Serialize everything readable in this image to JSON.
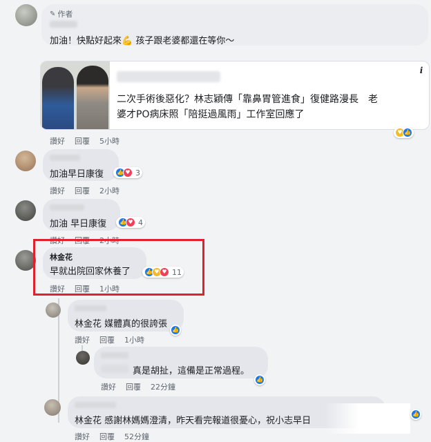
{
  "comments": [
    {
      "author_badge": "作者",
      "text": "加油！快點好起來💪 孩子跟老婆都還在等你～",
      "link_preview": {
        "headline_line1": "二次手術後惡化？林志穎傳「靠鼻胃管進食」復健路漫長　老",
        "headline_line2": "婆才PO病床照「陪挺過風雨」工作室回應了",
        "info_icon": "i"
      },
      "meta": {
        "like": "讚好",
        "reply": "回覆",
        "time": "5小時"
      }
    },
    {
      "text": "加油早日康復",
      "reaction_count": "3",
      "meta": {
        "like": "讚好",
        "reply": "回覆",
        "time": "2小時"
      }
    },
    {
      "text": "加油 早日康復",
      "reaction_count": "4",
      "meta": {
        "like": "讚好",
        "reply": "回覆",
        "time": "2小時"
      }
    },
    {
      "author": "林金花",
      "text": "早就出院回家休養了",
      "reaction_count": "11",
      "meta": {
        "like": "讚好",
        "reply": "回覆",
        "time": "1小時"
      }
    }
  ],
  "replies": [
    {
      "text": "林金花 媒體真的很誇張",
      "meta": {
        "like": "讚好",
        "reply": "回覆",
        "time": "1小時"
      }
    },
    {
      "text": "真是胡扯，這備是正常過程。",
      "meta": {
        "like": "讚好",
        "reply": "回覆",
        "time": "22分鐘"
      }
    },
    {
      "text": "林金花 感謝林媽媽澄清，昨天看完報道很憂心，祝小志早日",
      "meta": {
        "like": "讚好",
        "reply": "回覆",
        "time": "52分鐘"
      }
    }
  ],
  "icons": {
    "like": "like-reaction-icon",
    "love": "love-reaction-icon",
    "care": "care-reaction-icon",
    "pencil": "pencil-icon",
    "info": "info-icon"
  },
  "colors": {
    "highlight_border": "#e0202a",
    "like_blue": "#1877f2",
    "love_red": "#f33e58",
    "care_yellow": "#f7b928"
  }
}
